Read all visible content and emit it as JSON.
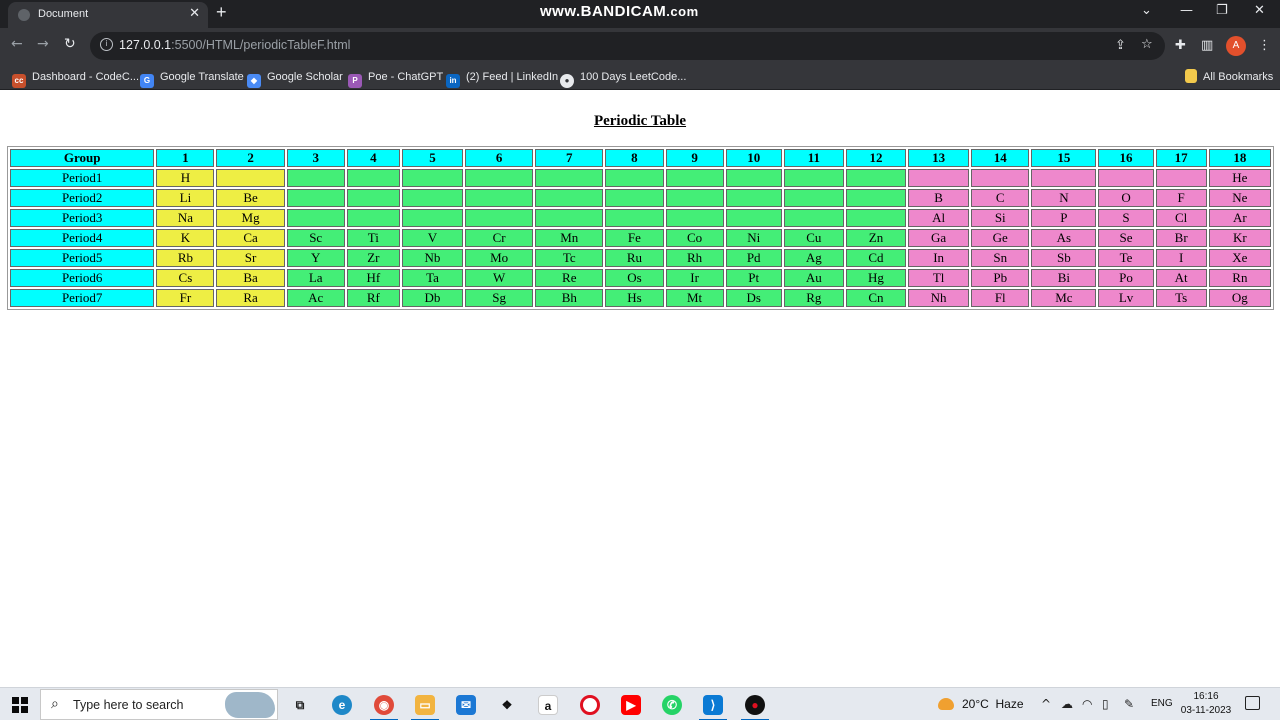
{
  "browser": {
    "tab_title": "Document",
    "tab_close": "✕",
    "new_tab": "+",
    "recorder_watermark_main": "www.BANDICAM",
    "recorder_watermark_suffix": ".com",
    "url_host": "127.0.0.1",
    "url_rest": ":5500/HTML/periodicTableF.html",
    "bookmarks": [
      {
        "label": "Dashboard - CodeC...",
        "icon": "cc",
        "color": "#c8502c"
      },
      {
        "label": "Google Translate",
        "icon": "G",
        "color": "#4285f4"
      },
      {
        "label": "Google Scholar",
        "icon": "◆",
        "color": "#4a8bf5"
      },
      {
        "label": "Poe - ChatGPT",
        "icon": "P",
        "color": "#9b59b6"
      },
      {
        "label": "(2) Feed | LinkedIn",
        "icon": "in",
        "color": "#0a66c2"
      },
      {
        "label": "100 Days LeetCode...",
        "icon": "●",
        "color": "#e8eaed"
      }
    ],
    "all_bookmarks": "All Bookmarks"
  },
  "page": {
    "heading": "Periodic Table",
    "header_row": [
      "Group",
      "1",
      "2",
      "3",
      "4",
      "5",
      "6",
      "7",
      "8",
      "9",
      "10",
      "11",
      "12",
      "13",
      "14",
      "15",
      "16",
      "17",
      "18"
    ],
    "rows": [
      {
        "label": "Period1",
        "cells": [
          "H",
          "",
          "",
          "",
          "",
          "",
          "",
          "",
          "",
          "",
          "",
          "",
          "",
          "",
          "",
          "",
          "",
          "He"
        ]
      },
      {
        "label": "Period2",
        "cells": [
          "Li",
          "Be",
          "",
          "",
          "",
          "",
          "",
          "",
          "",
          "",
          "",
          "",
          "B",
          "C",
          "N",
          "O",
          "F",
          "Ne"
        ]
      },
      {
        "label": "Period3",
        "cells": [
          "Na",
          "Mg",
          "",
          "",
          "",
          "",
          "",
          "",
          "",
          "",
          "",
          "",
          "Al",
          "Si",
          "P",
          "S",
          "Cl",
          "Ar"
        ]
      },
      {
        "label": "Period4",
        "cells": [
          "K",
          "Ca",
          "Sc",
          "Ti",
          "V",
          "Cr",
          "Mn",
          "Fe",
          "Co",
          "Ni",
          "Cu",
          "Zn",
          "Ga",
          "Ge",
          "As",
          "Se",
          "Br",
          "Kr"
        ]
      },
      {
        "label": "Period5",
        "cells": [
          "Rb",
          "Sr",
          "Y",
          "Zr",
          "Nb",
          "Mo",
          "Tc",
          "Ru",
          "Rh",
          "Pd",
          "Ag",
          "Cd",
          "In",
          "Sn",
          "Sb",
          "Te",
          "I",
          "Xe"
        ]
      },
      {
        "label": "Period6",
        "cells": [
          "Cs",
          "Ba",
          "La",
          "Hf",
          "Ta",
          "W",
          "Re",
          "Os",
          "Ir",
          "Pt",
          "Au",
          "Hg",
          "Tl",
          "Pb",
          "Bi",
          "Po",
          "At",
          "Rn"
        ]
      },
      {
        "label": "Period7",
        "cells": [
          "Fr",
          "Ra",
          "Ac",
          "Rf",
          "Db",
          "Sg",
          "Bh",
          "Hs",
          "Mt",
          "Ds",
          "Rg",
          "Cn",
          "Nh",
          "Fl",
          "Mc",
          "Lv",
          "Ts",
          "Og"
        ]
      }
    ],
    "colors": {
      "header": "#00ffff",
      "s_block": "#eeee44",
      "d_block": "#44ee77",
      "p_block": "#ee88cc"
    }
  },
  "taskbar": {
    "search_placeholder": "Type here to search",
    "temperature": "20°C",
    "weather_text": "Haze",
    "language": "ENG",
    "time": "16:16",
    "date": "03-11-2023"
  }
}
